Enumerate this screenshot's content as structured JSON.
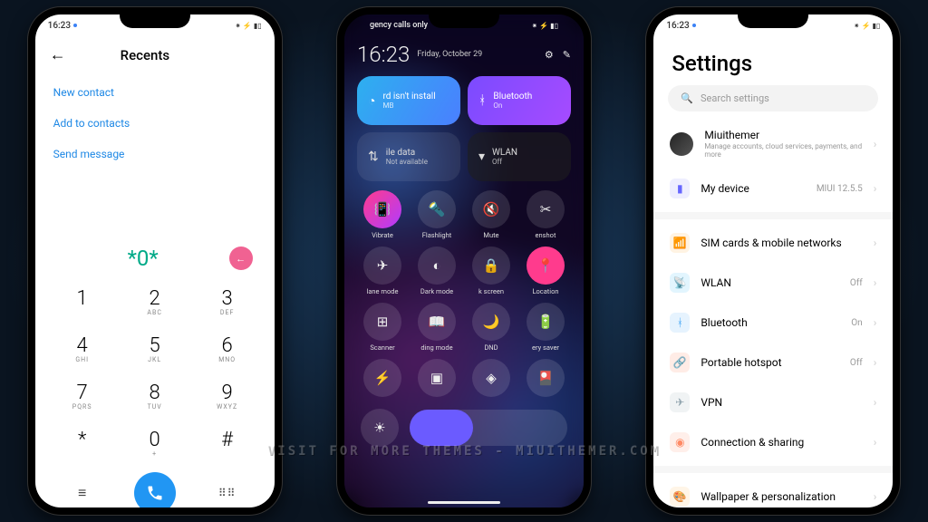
{
  "statusbar": {
    "time": "16:23",
    "right": "⁕ ⚡ ▮▯"
  },
  "dialer": {
    "title": "Recents",
    "actions": [
      "New contact",
      "Add to contacts",
      "Send message"
    ],
    "input": "*0*",
    "keys": [
      {
        "d": "1",
        "l": ""
      },
      {
        "d": "2",
        "l": "ABC"
      },
      {
        "d": "3",
        "l": "DEF"
      },
      {
        "d": "4",
        "l": "GHI"
      },
      {
        "d": "5",
        "l": "JKL"
      },
      {
        "d": "6",
        "l": "MNO"
      },
      {
        "d": "7",
        "l": "PQRS"
      },
      {
        "d": "8",
        "l": "TUV"
      },
      {
        "d": "9",
        "l": "WXYZ"
      },
      {
        "d": "*",
        "l": ""
      },
      {
        "d": "0",
        "l": "+"
      },
      {
        "d": "#",
        "l": ""
      }
    ]
  },
  "control": {
    "carrier": "gency calls only",
    "time": "16:23",
    "date": "Friday, October 29",
    "tiles": {
      "sim": {
        "label": "rd isn't install",
        "sub": "MB"
      },
      "bt": {
        "label": "Bluetooth",
        "sub": "On"
      },
      "data": {
        "label": "ile data",
        "sub": "Not available"
      },
      "wlan": {
        "label": "WLAN",
        "sub": "Off"
      }
    },
    "toggles": [
      {
        "glyph": "📳",
        "label": "Vibrate",
        "on": true
      },
      {
        "glyph": "🔦",
        "label": "Flashlight",
        "on": false
      },
      {
        "glyph": "🔇",
        "label": "Mute",
        "on": false
      },
      {
        "glyph": "✂",
        "label": "enshot",
        "on": false
      },
      {
        "glyph": "✈",
        "label": "lane mode",
        "on": false
      },
      {
        "glyph": "◐",
        "label": "Dark mode",
        "on": false
      },
      {
        "glyph": "🔒",
        "label": "k screen",
        "on": false
      },
      {
        "glyph": "📍",
        "label": "Location",
        "on": true,
        "loc": true
      },
      {
        "glyph": "⊞",
        "label": "Scanner",
        "on": false
      },
      {
        "glyph": "📖",
        "label": "ding mode",
        "on": false
      },
      {
        "glyph": "🌙",
        "label": "DND",
        "on": false
      },
      {
        "glyph": "🔋",
        "label": "ery saver",
        "on": false
      },
      {
        "glyph": "⚡",
        "label": "",
        "on": false
      },
      {
        "glyph": "▣",
        "label": "",
        "on": false
      },
      {
        "glyph": "◈",
        "label": "",
        "on": false
      },
      {
        "glyph": "🎴",
        "label": "",
        "on": false
      }
    ]
  },
  "settings": {
    "title": "Settings",
    "search_placeholder": "Search settings",
    "account": {
      "name": "Miuithemer",
      "sub": "Manage accounts, cloud services, payments, and more"
    },
    "device": {
      "label": "My device",
      "value": "MIUI 12.5.5"
    },
    "items": [
      {
        "icon": "📶",
        "bg": "#ffa726",
        "label": "SIM cards & mobile networks",
        "value": ""
      },
      {
        "icon": "📡",
        "bg": "#29b6f6",
        "label": "WLAN",
        "value": "Off"
      },
      {
        "icon": "ᚼ",
        "bg": "#42a5f5",
        "label": "Bluetooth",
        "value": "On"
      },
      {
        "icon": "🔗",
        "bg": "#ff7043",
        "label": "Portable hotspot",
        "value": "Off"
      },
      {
        "icon": "✈",
        "bg": "#90a4ae",
        "label": "VPN",
        "value": ""
      },
      {
        "icon": "◉",
        "bg": "#ff8a65",
        "label": "Connection & sharing",
        "value": ""
      }
    ],
    "items2": [
      {
        "icon": "🎨",
        "bg": "#ffb74d",
        "label": "Wallpaper & personalization",
        "value": ""
      }
    ]
  },
  "watermark": "Visit for more themes - miuithemer.com"
}
